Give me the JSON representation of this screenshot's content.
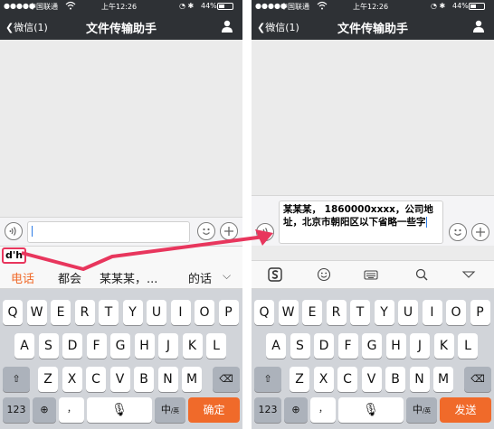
{
  "status": {
    "carrier": "中国联通",
    "time": "上午12:26",
    "battery": "44%",
    "battery_level": 0.44
  },
  "nav": {
    "back_label": "微信(1)",
    "title": "文件传输助手"
  },
  "left": {
    "pinyin": "d'h",
    "candidates": [
      "电话",
      "都会",
      "某某某，...",
      "的话"
    ],
    "keyboard": {
      "row1": [
        "Q",
        "W",
        "E",
        "R",
        "T",
        "Y",
        "U",
        "I",
        "O",
        "P"
      ],
      "row2": [
        "A",
        "S",
        "D",
        "F",
        "G",
        "H",
        "J",
        "K",
        "L"
      ],
      "row3": [
        "Z",
        "X",
        "C",
        "V",
        "B",
        "N",
        "M"
      ],
      "key_123": "123",
      "key_lang": "中",
      "key_lang_sub": "/英",
      "key_confirm": "确定"
    }
  },
  "right": {
    "message_text": "某某某， 1860000xxxx，公司地址，北京市朝阳区以下省略一些字",
    "keyboard": {
      "row1": [
        "Q",
        "W",
        "E",
        "R",
        "T",
        "Y",
        "U",
        "I",
        "O",
        "P"
      ],
      "row2": [
        "A",
        "S",
        "D",
        "F",
        "G",
        "H",
        "J",
        "K",
        "L"
      ],
      "row3": [
        "Z",
        "X",
        "C",
        "V",
        "B",
        "N",
        "M"
      ],
      "key_123": "123",
      "key_lang": "中",
      "key_lang_sub": "/英",
      "key_send": "发送"
    }
  },
  "colors": {
    "nav_bg": "#2e3135",
    "accent": "#f06a2a",
    "highlight": "#e8365d"
  }
}
